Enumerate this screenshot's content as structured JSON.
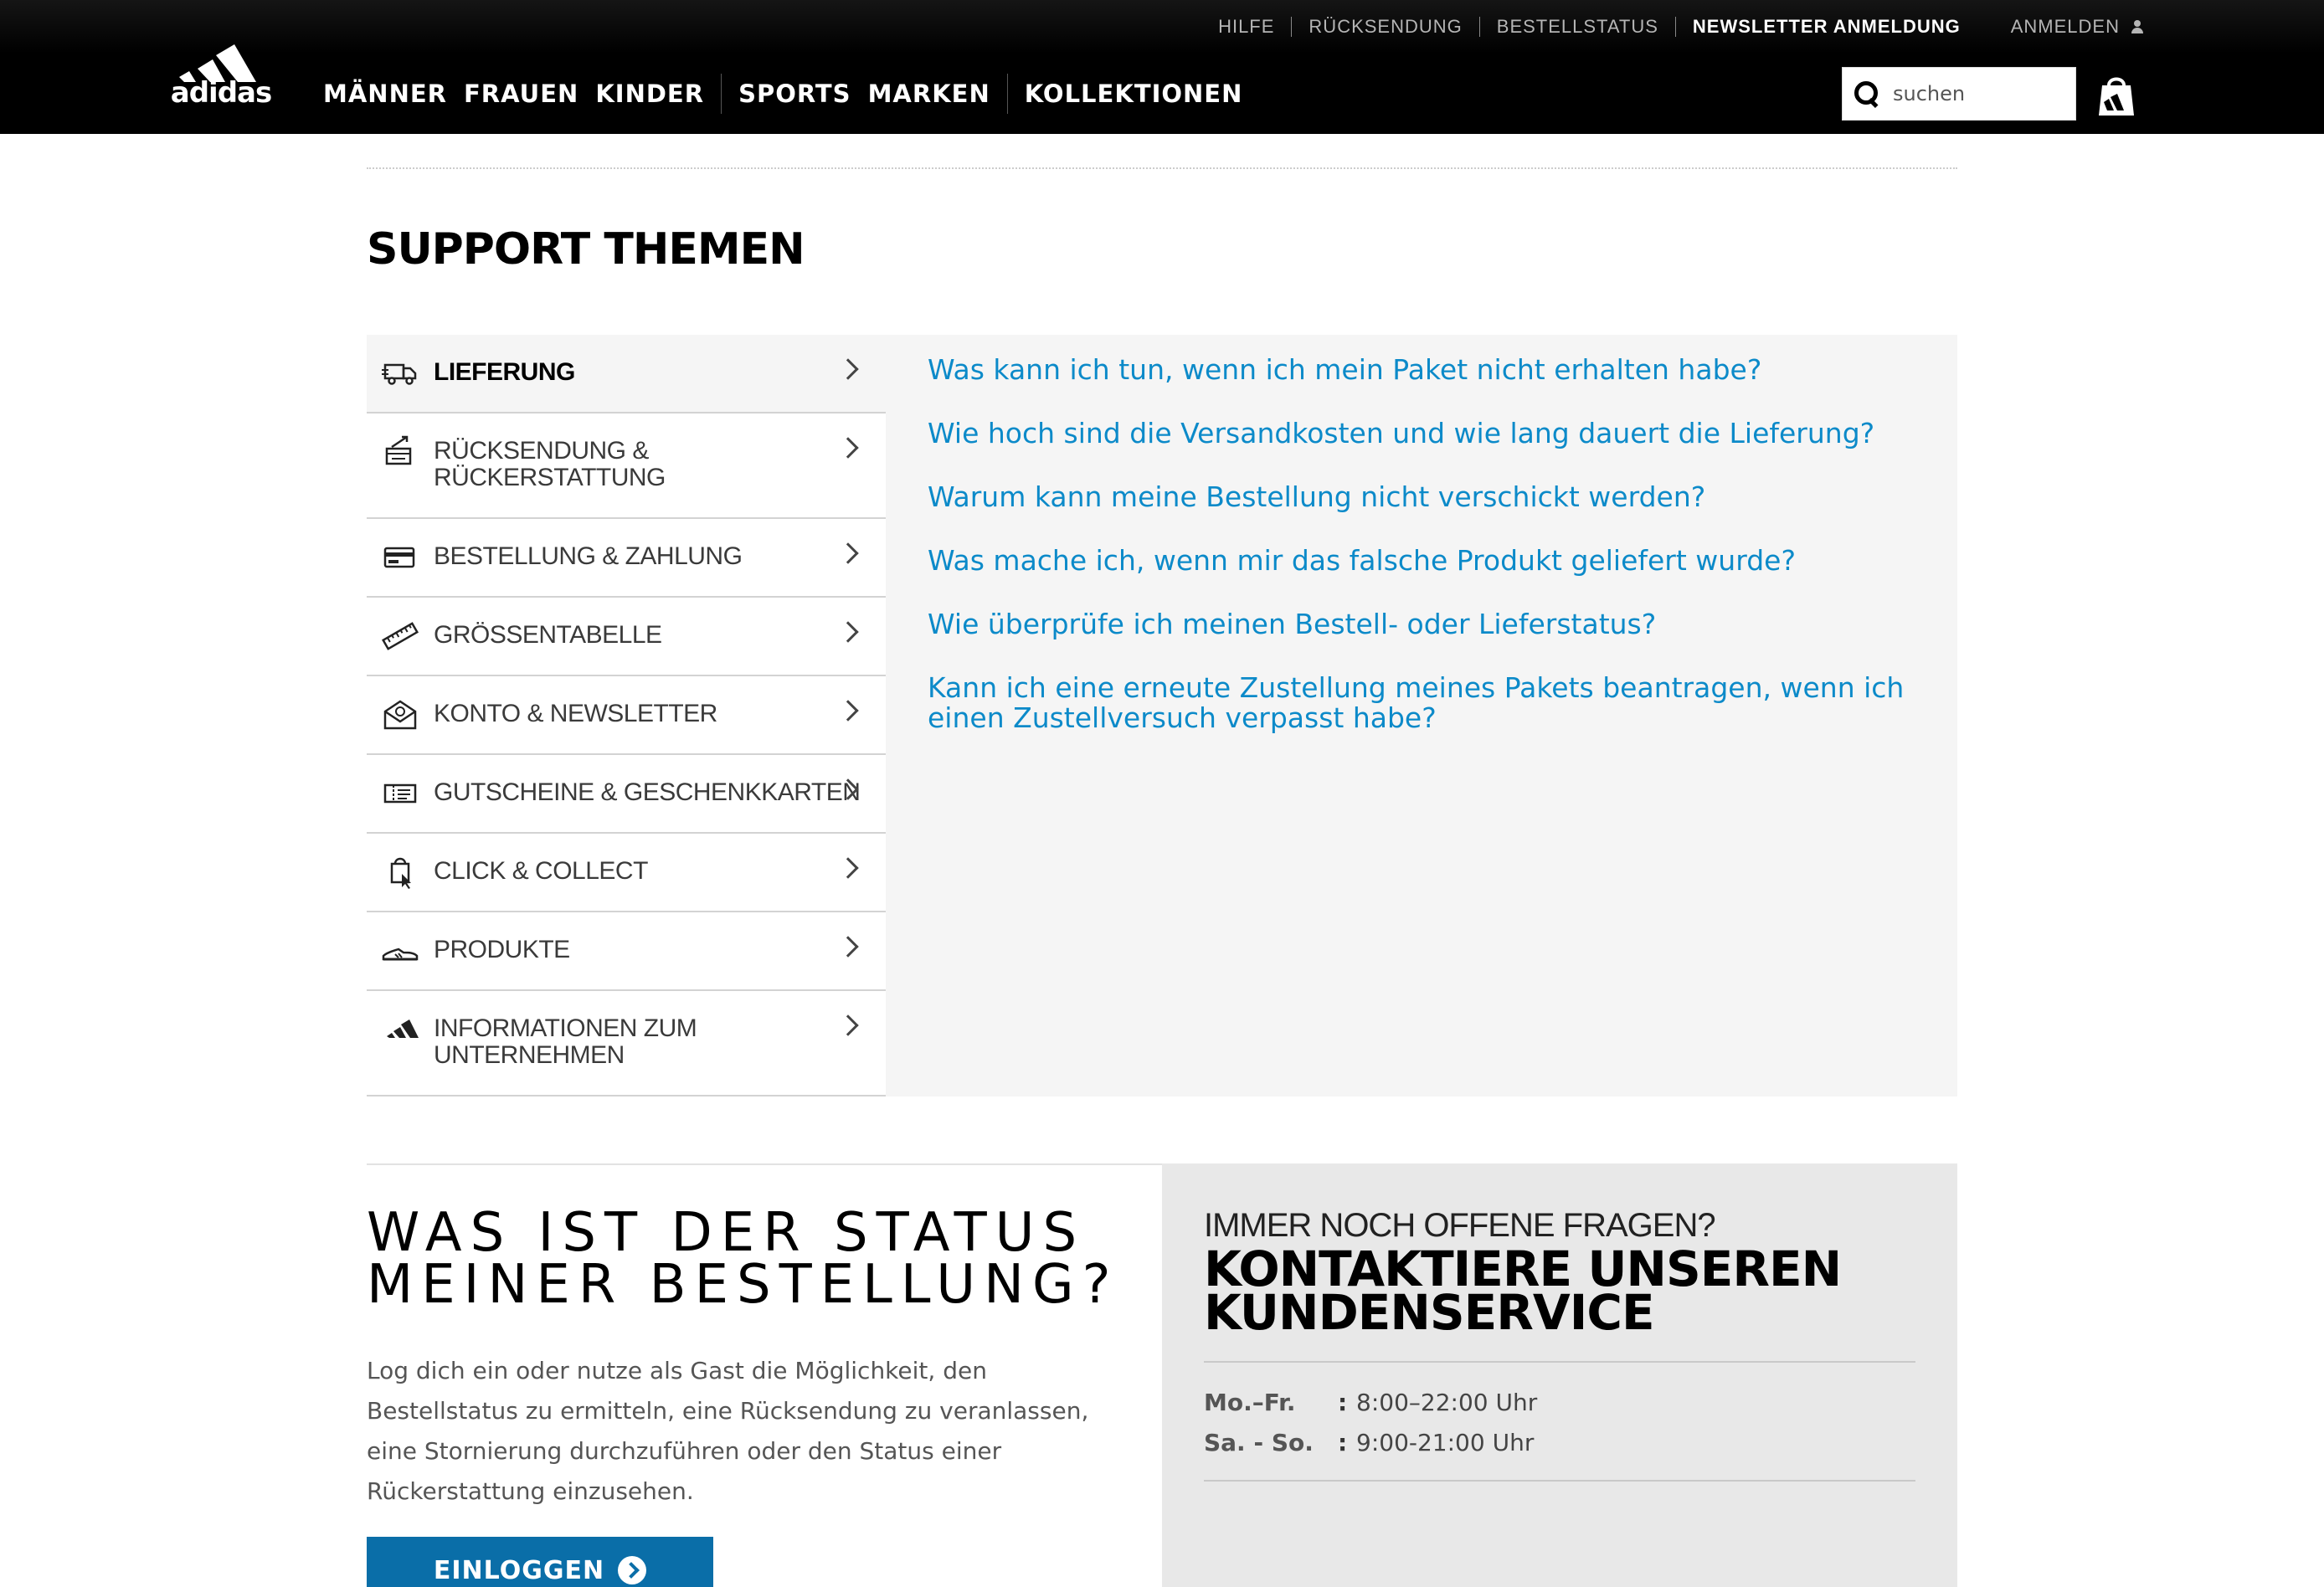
{
  "header": {
    "utility_links": [
      "HILFE",
      "RÜCKSENDUNG",
      "BESTELLSTATUS"
    ],
    "newsletter": "NEWSLETTER ANMELDUNG",
    "login": "ANMELDEN",
    "logo_text": "adidas",
    "nav_group1": [
      "MÄNNER",
      "FRAUEN",
      "KINDER"
    ],
    "nav_group2": [
      "SPORTS",
      "MARKEN"
    ],
    "nav_group3": [
      "KOLLEKTIONEN"
    ],
    "search_placeholder": "suchen"
  },
  "main": {
    "title": "SUPPORT THEMEN",
    "topics": [
      {
        "label": "LIEFERUNG",
        "icon": "truck-icon",
        "active": true
      },
      {
        "label": "RÜCKSENDUNG & RÜCKERSTATTUNG",
        "icon": "return-icon"
      },
      {
        "label": "BESTELLUNG & ZAHLUNG",
        "icon": "credit-card-icon"
      },
      {
        "label": "GRÖSSENTABELLE",
        "icon": "ruler-icon"
      },
      {
        "label": "KONTO & NEWSLETTER",
        "icon": "envelope-icon"
      },
      {
        "label": "GUTSCHEINE & GESCHENKKARTEN",
        "icon": "voucher-icon"
      },
      {
        "label": "CLICK & COLLECT",
        "icon": "shopping-bag-cursor-icon"
      },
      {
        "label": "PRODUKTE",
        "icon": "shoe-icon"
      },
      {
        "label": "INFORMATIONEN ZUM UNTERNEHMEN",
        "icon": "adidas-logo-icon"
      }
    ],
    "faqs": [
      "Was kann ich tun, wenn ich mein Paket nicht erhalten habe?",
      "Wie hoch sind die Versandkosten und wie lang dauert die Lieferung?",
      "Warum kann meine Bestellung nicht verschickt werden?",
      "Was mache ich, wenn mir das falsche Produkt geliefert wurde?",
      "Wie überprüfe ich meinen Bestell- oder Lieferstatus?",
      "Kann ich eine erneute Zustellung meines Pakets beantragen, wenn ich einen Zustellversuch verpasst habe?"
    ]
  },
  "status": {
    "title": "WAS IST DER STATUS MEINER BESTELLUNG?",
    "text": "Log dich ein oder nutze als Gast die Möglichkeit, den Bestellstatus zu ermitteln, eine Rücksendung zu veranlassen, eine Stornierung durchzuführen oder den Status einer Rückerstattung einzusehen.",
    "button": "EINLOGGEN"
  },
  "contact": {
    "kicker": "IMMER NOCH OFFENE FRAGEN?",
    "title": "KONTAKTIERE UNSEREN KUNDENSERVICE",
    "hours": [
      {
        "day": "Mo.–Fr.:",
        "time": "8:00–22:00 Uhr"
      },
      {
        "day": "Sa. - So.:",
        "time": "9:00-21:00 Uhr"
      }
    ]
  },
  "colors": {
    "link": "#0c8ac9",
    "button": "#0a6ea8",
    "header": "#000000"
  }
}
